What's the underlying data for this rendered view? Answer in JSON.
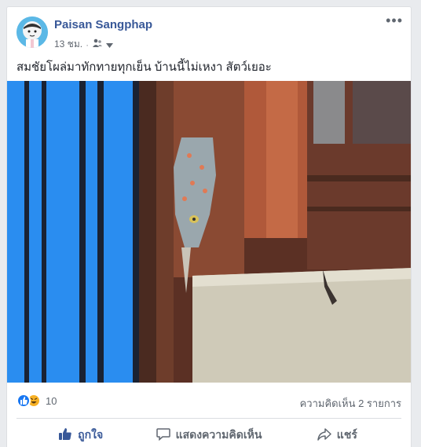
{
  "post": {
    "author": "Paisan Sangphap",
    "time": "13 ชม.",
    "text": "สมชัยโผล่มาทักทายทุกเย็น บ้านนี้ไม่เหงา สัตว์เยอะ",
    "more_label": "•••"
  },
  "stats": {
    "reaction_count": "10",
    "comments_label": "ความคิดเห็น 2 รายการ"
  },
  "actions": {
    "like": "ถูกใจ",
    "comment": "แสดงความคิดเห็น",
    "share": "แชร์"
  },
  "colors": {
    "link_blue": "#385898",
    "like_blue": "#1877f2",
    "haha_yellow": "#f7b125"
  }
}
